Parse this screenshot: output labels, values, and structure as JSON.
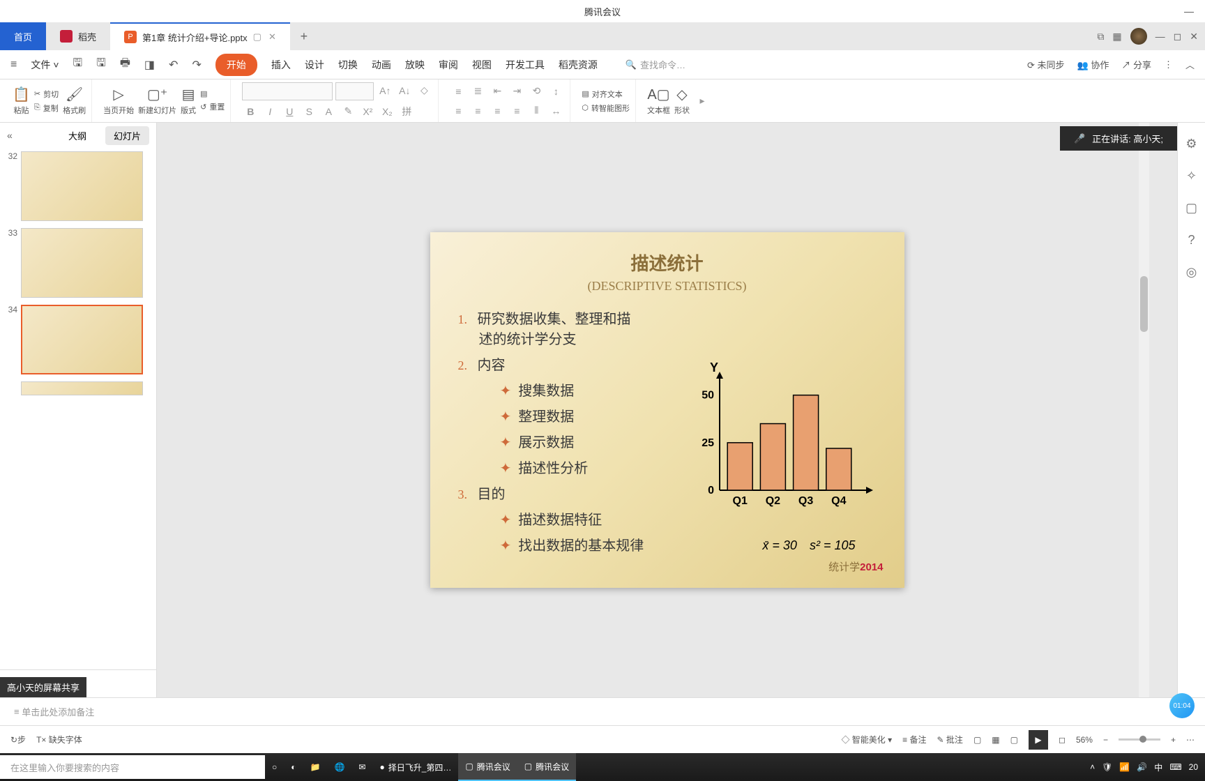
{
  "window": {
    "title": "腾讯会议"
  },
  "tabs": {
    "home": "首页",
    "daoke": "稻壳",
    "file": "第1章 统计介绍+导论.pptx"
  },
  "menu": {
    "file": "文件",
    "items": [
      "开始",
      "插入",
      "设计",
      "切换",
      "动画",
      "放映",
      "审阅",
      "视图",
      "开发工具",
      "稻壳资源"
    ],
    "search_ph": "查找命令…",
    "unsync": "未同步",
    "collab": "协作",
    "share": "分享"
  },
  "ribbon": {
    "paste": "粘贴",
    "cut": "剪切",
    "copy": "复制",
    "format_painter": "格式刷",
    "from_current": "当页开始",
    "new_slide": "新建幻灯片",
    "layout": "版式",
    "reset": "重置",
    "align_text": "对齐文本",
    "smart_graphic": "转智能图形",
    "text_box": "文本框",
    "shapes": "形状"
  },
  "thumbs": {
    "outline": "大纲",
    "slides": "幻灯片",
    "items": [
      {
        "n": "32"
      },
      {
        "n": "33"
      },
      {
        "n": "34"
      }
    ]
  },
  "slide": {
    "title": "描述统计",
    "subtitle": "(DESCRIPTIVE STATISTICS)",
    "p1": "研究数据收集、整理和描述的统计学分支",
    "p2": "内容",
    "b1": "搜集数据",
    "b2": "整理数据",
    "b3": "展示数据",
    "b4": "描述性分析",
    "p3": "目的",
    "b5": "描述数据特征",
    "b6": "找出数据的基本规律",
    "stat1": "x̄ = 30",
    "stat2": "s² = 105",
    "footer_pre": "统计学",
    "footer_year": "2014"
  },
  "chart_data": {
    "type": "bar",
    "categories": [
      "Q1",
      "Q2",
      "Q3",
      "Q4"
    ],
    "values": [
      25,
      35,
      50,
      22
    ],
    "ylabel": "Y",
    "yticks": [
      0,
      25,
      50
    ],
    "ylim": [
      0,
      55
    ]
  },
  "speaker": {
    "label": "正在讲话: 高小天;"
  },
  "notes": {
    "placeholder": "单击此处添加备注"
  },
  "status": {
    "missing_font": "缺失字体",
    "smart": "智能美化",
    "notes": "备注",
    "annotate": "批注",
    "zoom": "56%",
    "timer": "01:04"
  },
  "share_label": "高小天的屏幕共享",
  "taskbar": {
    "search_ph": "在这里输入你要搜索的内容",
    "app1": "择日飞升_第四…",
    "app2": "腾讯会议",
    "app3": "腾讯会议",
    "ime": "中",
    "time_frag": "20"
  }
}
